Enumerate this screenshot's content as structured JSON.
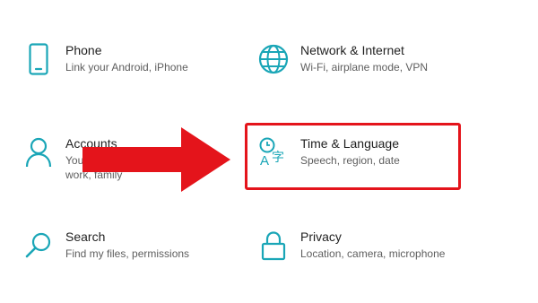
{
  "accent_color": "#1aa6b7",
  "annotation_color": "#e4141b",
  "settings": [
    {
      "id": "phone",
      "icon": "phone-icon",
      "title": "Phone",
      "description": "Link your Android, iPhone"
    },
    {
      "id": "network",
      "icon": "globe-icon",
      "title": "Network & Internet",
      "description": "Wi-Fi, airplane mode, VPN"
    },
    {
      "id": "accounts",
      "icon": "person-icon",
      "title": "Accounts",
      "description": "Your accounts, email, sync, work, family"
    },
    {
      "id": "time",
      "icon": "time-language-icon",
      "title": "Time & Language",
      "description": "Speech, region, date"
    },
    {
      "id": "search",
      "icon": "search-icon",
      "title": "Search",
      "description": "Find my files, permissions"
    },
    {
      "id": "privacy",
      "icon": "lock-icon",
      "title": "Privacy",
      "description": "Location, camera, microphone"
    }
  ]
}
